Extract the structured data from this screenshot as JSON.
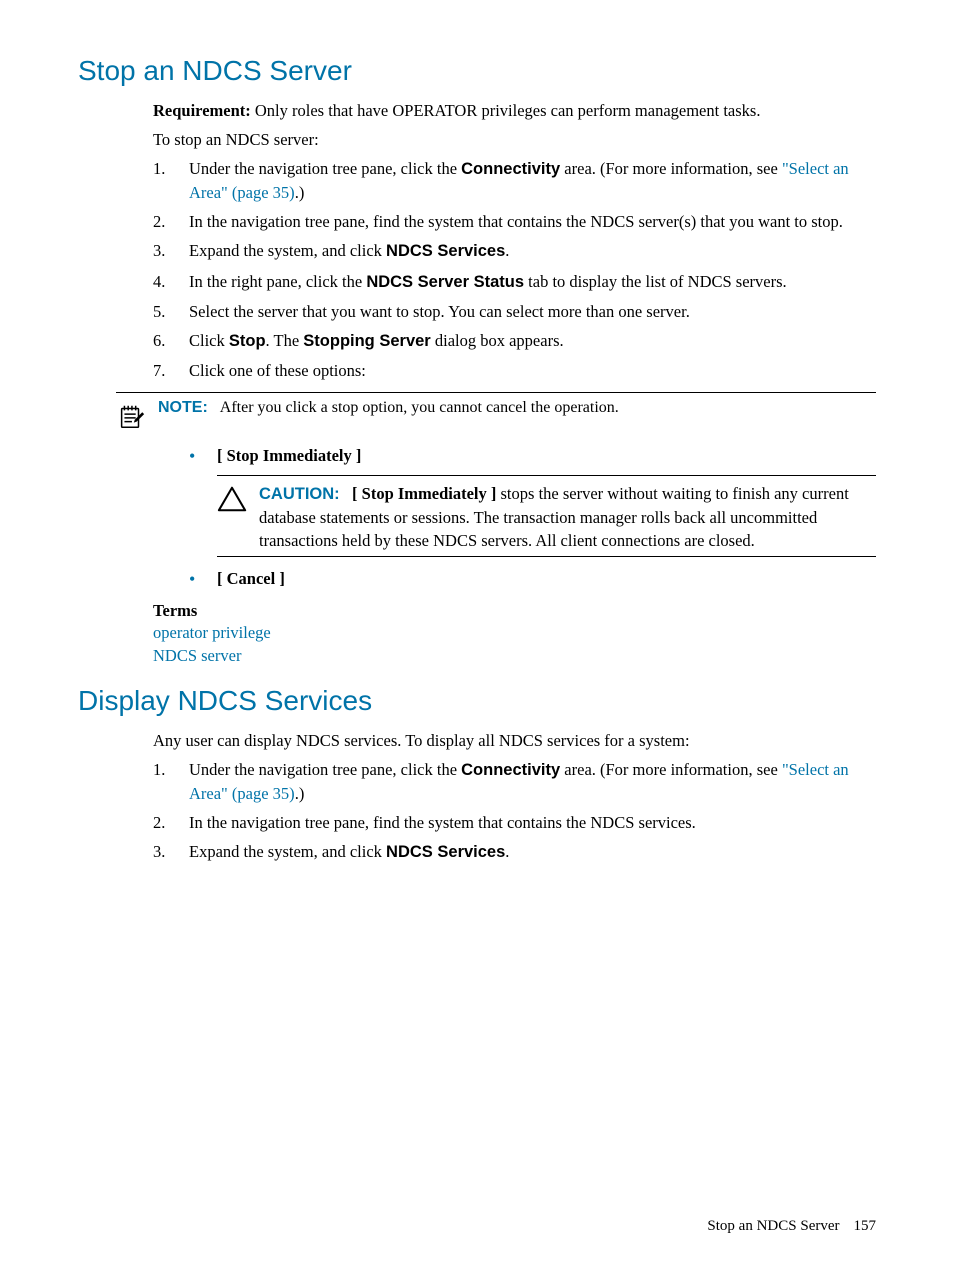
{
  "section1": {
    "heading": "Stop an NDCS Server",
    "req_label": "Requirement:",
    "req_text": " Only roles that have OPERATOR privileges can perform management tasks.",
    "intro": "To stop an NDCS server:",
    "steps": [
      {
        "num": "1.",
        "pre": "Under the navigation tree pane, click the ",
        "bold": "Connectivity",
        "post1": " area. (For more information, see ",
        "link": "\"Select an Area\" (page 35)",
        "post2": ".)"
      },
      {
        "num": "2.",
        "text": "In the navigation tree pane, find the system that contains the NDCS server(s) that you want to stop."
      },
      {
        "num": "3.",
        "pre": "Expand the system, and click ",
        "bold": "NDCS Services",
        "post": "."
      },
      {
        "num": "4.",
        "pre": "In the right pane, click the ",
        "bold": "NDCS Server Status",
        "post": " tab to display the list of NDCS servers."
      },
      {
        "num": "5.",
        "text": "Select the server that you want to stop. You can select more than one server."
      },
      {
        "num": "6.",
        "pre": "Click ",
        "bold": "Stop",
        "mid": ". The ",
        "bold2": "Stopping Server",
        "post": " dialog box appears."
      },
      {
        "num": "7.",
        "text": "Click one of these options:"
      }
    ],
    "note_label": "NOTE:",
    "note_text": "After you click a stop option, you cannot cancel the operation.",
    "bullet1": "[ Stop Immediately ]",
    "caution_label": "CAUTION:",
    "caution_bold": "[ Stop Immediately ]",
    "caution_text": " stops the server without waiting to finish any current database statements or sessions. The transaction manager rolls back all uncommitted transactions held by these NDCS servers. All client connections are closed.",
    "bullet2": "[ Cancel ]",
    "terms_heading": "Terms",
    "term1": "operator privilege",
    "term2": "NDCS server"
  },
  "section2": {
    "heading": "Display NDCS Services",
    "intro": "Any user can display NDCS services. To display all NDCS services for a system:",
    "steps": [
      {
        "num": "1.",
        "pre": "Under the navigation tree pane, click the ",
        "bold": "Connectivity",
        "post1": " area. (For more information, see ",
        "link": "\"Select an Area\" (page 35)",
        "post2": ".)"
      },
      {
        "num": "2.",
        "text": "In the navigation tree pane, find the system that contains the NDCS services."
      },
      {
        "num": "3.",
        "pre": "Expand the system, and click ",
        "bold": "NDCS Services",
        "post": "."
      }
    ]
  },
  "footer": {
    "title": "Stop an NDCS Server",
    "page": "157"
  }
}
